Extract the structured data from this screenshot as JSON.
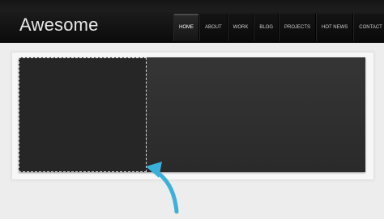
{
  "header": {
    "logo_text": "Awesome",
    "nav": [
      {
        "label": "HOME",
        "active": true
      },
      {
        "label": "ABOUT",
        "active": false
      },
      {
        "label": "WORK",
        "active": false
      },
      {
        "label": "BLOG",
        "active": false
      },
      {
        "label": "PROJECTS",
        "active": false
      },
      {
        "label": "HOT NEWS",
        "active": false
      },
      {
        "label": "CONTACT",
        "active": false
      }
    ]
  },
  "colors": {
    "accent_arrow": "#3bb0d9",
    "header_bg": "#0f0f0f",
    "slider_bg": "#303030"
  },
  "icons": {
    "annotation": "curved-arrow-icon"
  }
}
